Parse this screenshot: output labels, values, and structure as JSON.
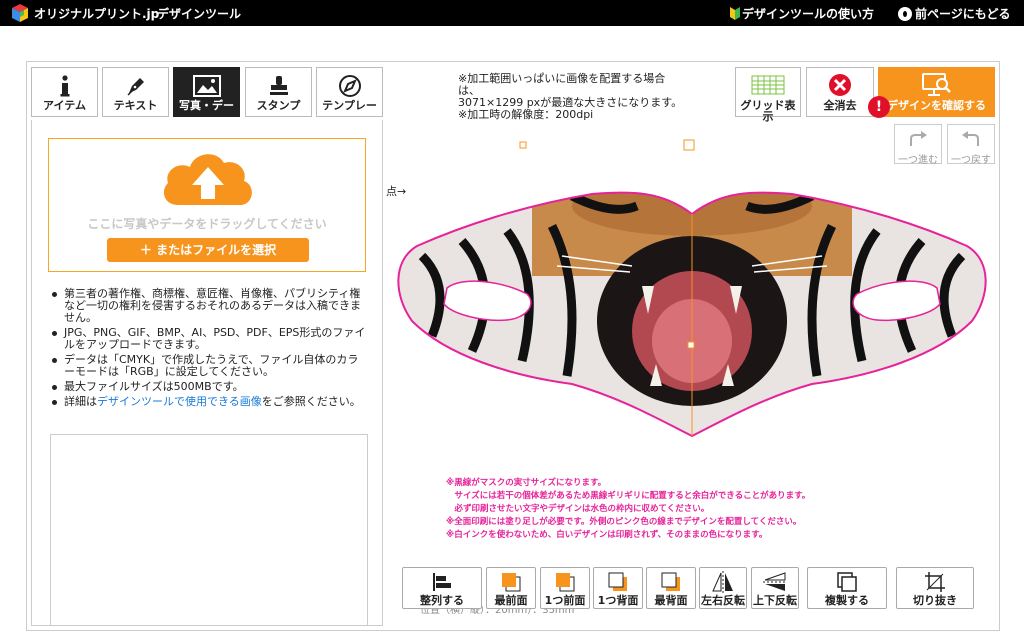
{
  "header": {
    "brand": "オリジナルプリント.jp",
    "tool_name": "デザインツール",
    "help_link": "デザインツールの使い方",
    "back_link": "前ページにもどる"
  },
  "tabs": [
    {
      "label": "アイテム",
      "icon": "info-icon"
    },
    {
      "label": "テキスト",
      "icon": "pen-icon"
    },
    {
      "label": "写真・デー",
      "icon": "photo-icon",
      "active": true
    },
    {
      "label": "スタンプ",
      "icon": "stamp-icon"
    },
    {
      "label": "テンプレー",
      "icon": "template-icon"
    }
  ],
  "upload": {
    "drop_text": "ここに写真やデータをドラッグしてください",
    "file_button": "＋ またはファイルを選択"
  },
  "notes": [
    "第三者の著作権、商標権、意匠権、肖像権、パブリシティ権など一切の権利を侵害するおそれのあるデータは入稿できません。",
    "JPG、PNG、GIF、BMP、AI、PSD、PDF、EPS形式のファイルをアップロードできます。",
    "データは「CMYK」で作成したうえで、ファイル自体のカラーモードは「RGB」に設定してください。",
    "最大ファイルサイズは500MBです。"
  ],
  "notes_link": {
    "prefix": "詳細は",
    "link": "デザインツールで使用できる画像",
    "suffix": "をご参照ください。"
  },
  "canvas_info": {
    "line1": "※加工範囲いっぱいに画像を配置する場合は、",
    "line2": "3071×1299 pxが最適な大きさになります。",
    "line3": "※加工時の解像度：200dpi",
    "dots": "点→"
  },
  "right_buttons": {
    "grid": "グリッド表示",
    "clear": "全消去",
    "confirm": "デザインを確認する",
    "alert": "!",
    "redo": "一つ進む",
    "undo": "一つ戻す"
  },
  "pink_notes": [
    "※黒線がマスクの実寸サイズになります。",
    "　サイズには若干の個体差があるため黒線ギリギリに配置すると余白ができることがあります。",
    "　必ず印刷させたい文字やデザインは水色の枠内に収めてください。",
    "※全面印刷には塗り足しが必要です。外側のピンク色の線までデザインを配置してください。",
    "※白インクを使わないため、白いデザインは印刷されず、そのままの色になります。"
  ],
  "size_info": "位置（横）縦）：20mm）：35mm",
  "toolbar": [
    {
      "label": "整列する",
      "icon": "align-icon"
    },
    {
      "label": "最前面",
      "icon": "bring-front-icon"
    },
    {
      "label": "1つ前面",
      "icon": "bring-forward-icon"
    },
    {
      "label": "1つ背面",
      "icon": "send-backward-icon"
    },
    {
      "label": "最背面",
      "icon": "send-back-icon"
    },
    {
      "label": "左右反転",
      "icon": "flip-horizontal-icon"
    },
    {
      "label": "上下反転",
      "icon": "flip-vertical-icon"
    },
    {
      "label": "複製する",
      "icon": "duplicate-icon"
    },
    {
      "label": "切り抜き",
      "icon": "crop-icon"
    }
  ],
  "colors": {
    "accent": "#f7941d",
    "alert": "#e0102a",
    "pink_line": "#e6239a",
    "link": "#1a7ad8",
    "grid_icon": "#7cc243"
  }
}
